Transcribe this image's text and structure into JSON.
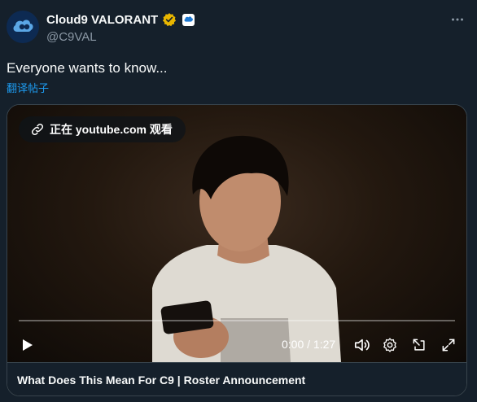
{
  "account": {
    "name": "Cloud9 VALORANT",
    "handle": "@C9VAL",
    "verified_color": "#e8b600",
    "accent": "#1d9bf0"
  },
  "tweet": {
    "text": "Everyone wants to know...",
    "translate_label": "翻译帖子"
  },
  "video": {
    "watch_on_label": "正在 youtube.com 观看",
    "time_display": "0:00 / 1:27",
    "progress": 0
  },
  "card": {
    "title": "What Does This Mean For C9 | Roster Announcement"
  },
  "icons": [
    "cloud9-logo-icon",
    "verified-badge-icon",
    "affiliate-badge-icon",
    "more-icon",
    "link-icon",
    "play-icon",
    "volume-icon",
    "settings-icon",
    "pop-out-icon",
    "fullscreen-icon"
  ]
}
